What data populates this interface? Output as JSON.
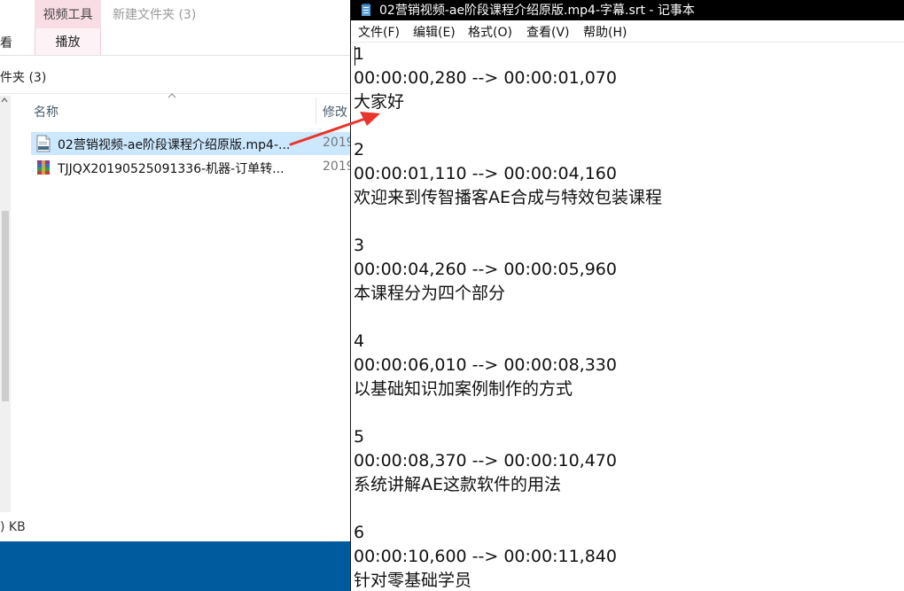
{
  "explorer": {
    "ribbon": {
      "context_header": "视频工具",
      "context_tab": "播放",
      "left_tab_partial": "查看",
      "window_title": "新建文件夹 (3)"
    },
    "address_text": "件夹 (3)",
    "columns": {
      "name": "名称",
      "modified": "修改"
    },
    "files": [
      {
        "name": "02营销视频-ae阶段课程介绍原版.mp4-...",
        "date": "2019",
        "icon": "srt-file-icon",
        "selected": true
      },
      {
        "name": "TJJQX20190525091336-机器-订单转...",
        "date": "2019",
        "icon": "winrar-archive-icon",
        "selected": false
      }
    ],
    "status_size": ") KB",
    "taskbar_color": "#005a9e"
  },
  "notepad": {
    "title": "02营销视频-ae阶段课程介绍原版.mp4-字幕.srt - 记事本",
    "menu": [
      "文件(F)",
      "编辑(E)",
      "格式(O)",
      "查看(V)",
      "帮助(H)"
    ],
    "lines": [
      "1",
      "00:00:00,280 --> 00:00:01,070",
      "大家好",
      "",
      "2",
      "00:00:01,110 --> 00:00:04,160",
      "欢迎来到传智播客AE合成与特效包装课程",
      "",
      "3",
      "00:00:04,260 --> 00:00:05,960",
      "本课程分为四个部分",
      "",
      "4",
      "00:00:06,010 --> 00:00:08,330",
      "以基础知识加案例制作的方式",
      "",
      "5",
      "00:00:08,370 --> 00:00:10,470",
      "系统讲解AE这款软件的用法",
      "",
      "6",
      "00:00:10,600 --> 00:00:11,840",
      "针对零基础学员"
    ]
  },
  "annotation": {
    "arrow_color": "#e8352b"
  }
}
